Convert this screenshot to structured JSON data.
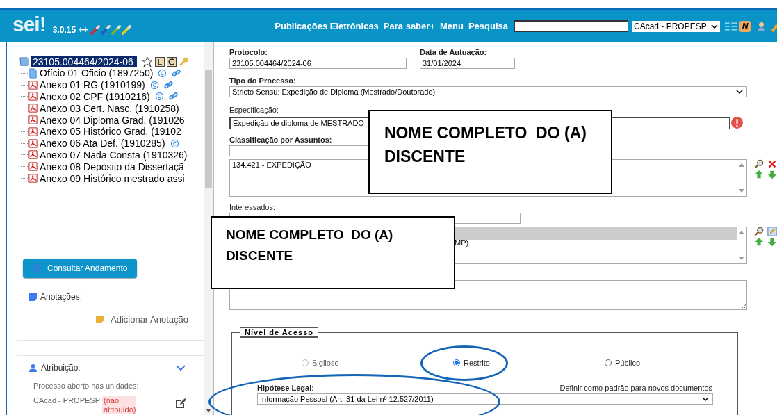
{
  "header": {
    "logo": "sei!",
    "version": "3.0.15 ++",
    "nav": [
      "Publicações Eletrônicas",
      "Para saber+",
      "Menu",
      "Pesquisa"
    ],
    "unit": "CAcad - PROPESP",
    "notice_badge": "N"
  },
  "tree": {
    "root": {
      "label": "23105.004464/2024-06",
      "selected": true
    },
    "items": [
      {
        "kind": "doc",
        "label": "Ofício 01 Oficio (1897250)",
        "copyright": true,
        "link": true
      },
      {
        "kind": "pdf",
        "label": "Anexo 01 RG (1910199)",
        "copyright": true,
        "link": true
      },
      {
        "kind": "pdf",
        "label": "Anexo 02 CPF (1910216)",
        "copyright": true,
        "link": true
      },
      {
        "kind": "pdf",
        "label": "Anexo 03 Cert. Nasc. (1910258)",
        "copyright": false,
        "link": false
      },
      {
        "kind": "pdf",
        "label": "Anexo 04 Diploma Grad. (191026",
        "copyright": false,
        "link": false
      },
      {
        "kind": "pdf",
        "label": "Anexo 05 Histórico Grad. (19102",
        "copyright": false,
        "link": false
      },
      {
        "kind": "pdf",
        "label": "Anexo 06 Ata Def. (1910285)",
        "copyright": true,
        "link": false
      },
      {
        "kind": "pdf",
        "label": "Anexo 07 Nada Consta (1910326)",
        "copyright": false,
        "link": false
      },
      {
        "kind": "pdf",
        "label": "Anexo 08 Depósito da Dissertaçã",
        "copyright": false,
        "link": false
      },
      {
        "kind": "pdf",
        "label": "Anexo 09 Histórico mestrado assi",
        "copyright": false,
        "link": false
      }
    ]
  },
  "sidebar": {
    "consult_button": "Consultar Andamento",
    "notes_label": "Anotações:",
    "add_note": "Adicionar Anotação",
    "assignment_label": "Atribuição:",
    "assignment_expanded": true,
    "open_units_label": "Processo aberto nas unidades:",
    "unit": "CAcad - PROPESP",
    "unit_status": "(não atribuído)"
  },
  "form": {
    "protocolo": {
      "label": "Protocolo:",
      "value": "23105.004464/2024-06"
    },
    "data": {
      "label": "Data de Autuação:",
      "value": "31/01/2024"
    },
    "tipo": {
      "label": "Tipo do Processo:",
      "value": "Stricto Sensu: Expedição de Diploma (Mestrado/Doutorado)"
    },
    "especificacao": {
      "label": "Especificação:",
      "value": "Expedição de diploma de MESTRADO"
    },
    "classificacao": {
      "label": "Classificação por Assuntos:",
      "items": [
        "134.421 - EXPEDIÇÃO"
      ]
    },
    "interessados": {
      "label": "Interessados:",
      "items": [
        "MP)"
      ]
    },
    "nivel": {
      "legend": "Nível de Acesso",
      "options": [
        {
          "label": "Sigiloso",
          "selected": false,
          "disabled": true
        },
        {
          "label": "Restrito",
          "selected": true,
          "disabled": false
        },
        {
          "label": "Público",
          "selected": false,
          "disabled": false
        }
      ]
    },
    "hipotese": {
      "label": "Hipótese Legal:",
      "default_link": "Definir como padrão para novos documentos",
      "value": "Informação Pessoal (Art. 31 da Lei nº 12.527/2011)"
    }
  },
  "annotations": [
    {
      "kind": "box",
      "text": "NOME COMPLETO  DO (A) DISCENTE"
    },
    {
      "kind": "box",
      "text": "NOME COMPLETO  DO (A) DISCENTE"
    },
    {
      "kind": "ellipse"
    },
    {
      "kind": "ellipse"
    }
  ]
}
